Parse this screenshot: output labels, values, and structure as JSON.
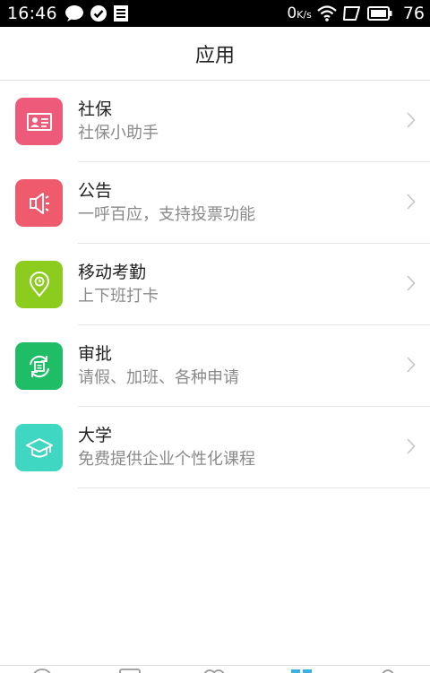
{
  "status_bar": {
    "time": "16:46",
    "network_speed_value": "0",
    "network_speed_unit": "K/s",
    "battery_level": "76"
  },
  "header": {
    "title": "应用"
  },
  "apps": [
    {
      "title": "社保",
      "subtitle": "社保小助手",
      "icon": "id-card-icon",
      "color": "#ee5a7a"
    },
    {
      "title": "公告",
      "subtitle": "一呼百应，支持投票功能",
      "icon": "megaphone-icon",
      "color": "#ef5a6c"
    },
    {
      "title": "移动考勤",
      "subtitle": "上下班打卡",
      "icon": "location-pin-icon",
      "color": "#8ccc1e"
    },
    {
      "title": "审批",
      "subtitle": "请假、加班、各种申请",
      "icon": "approval-cycle-icon",
      "color": "#1fbd66"
    },
    {
      "title": "大学",
      "subtitle": "免费提供企业个性化课程",
      "icon": "graduation-cap-icon",
      "color": "#3fd6c2"
    }
  ],
  "bottom_nav": {
    "items": [
      "chat-icon",
      "contacts-icon",
      "people-icon",
      "apps-icon",
      "profile-icon"
    ],
    "active_color": "#3ab0e8"
  }
}
